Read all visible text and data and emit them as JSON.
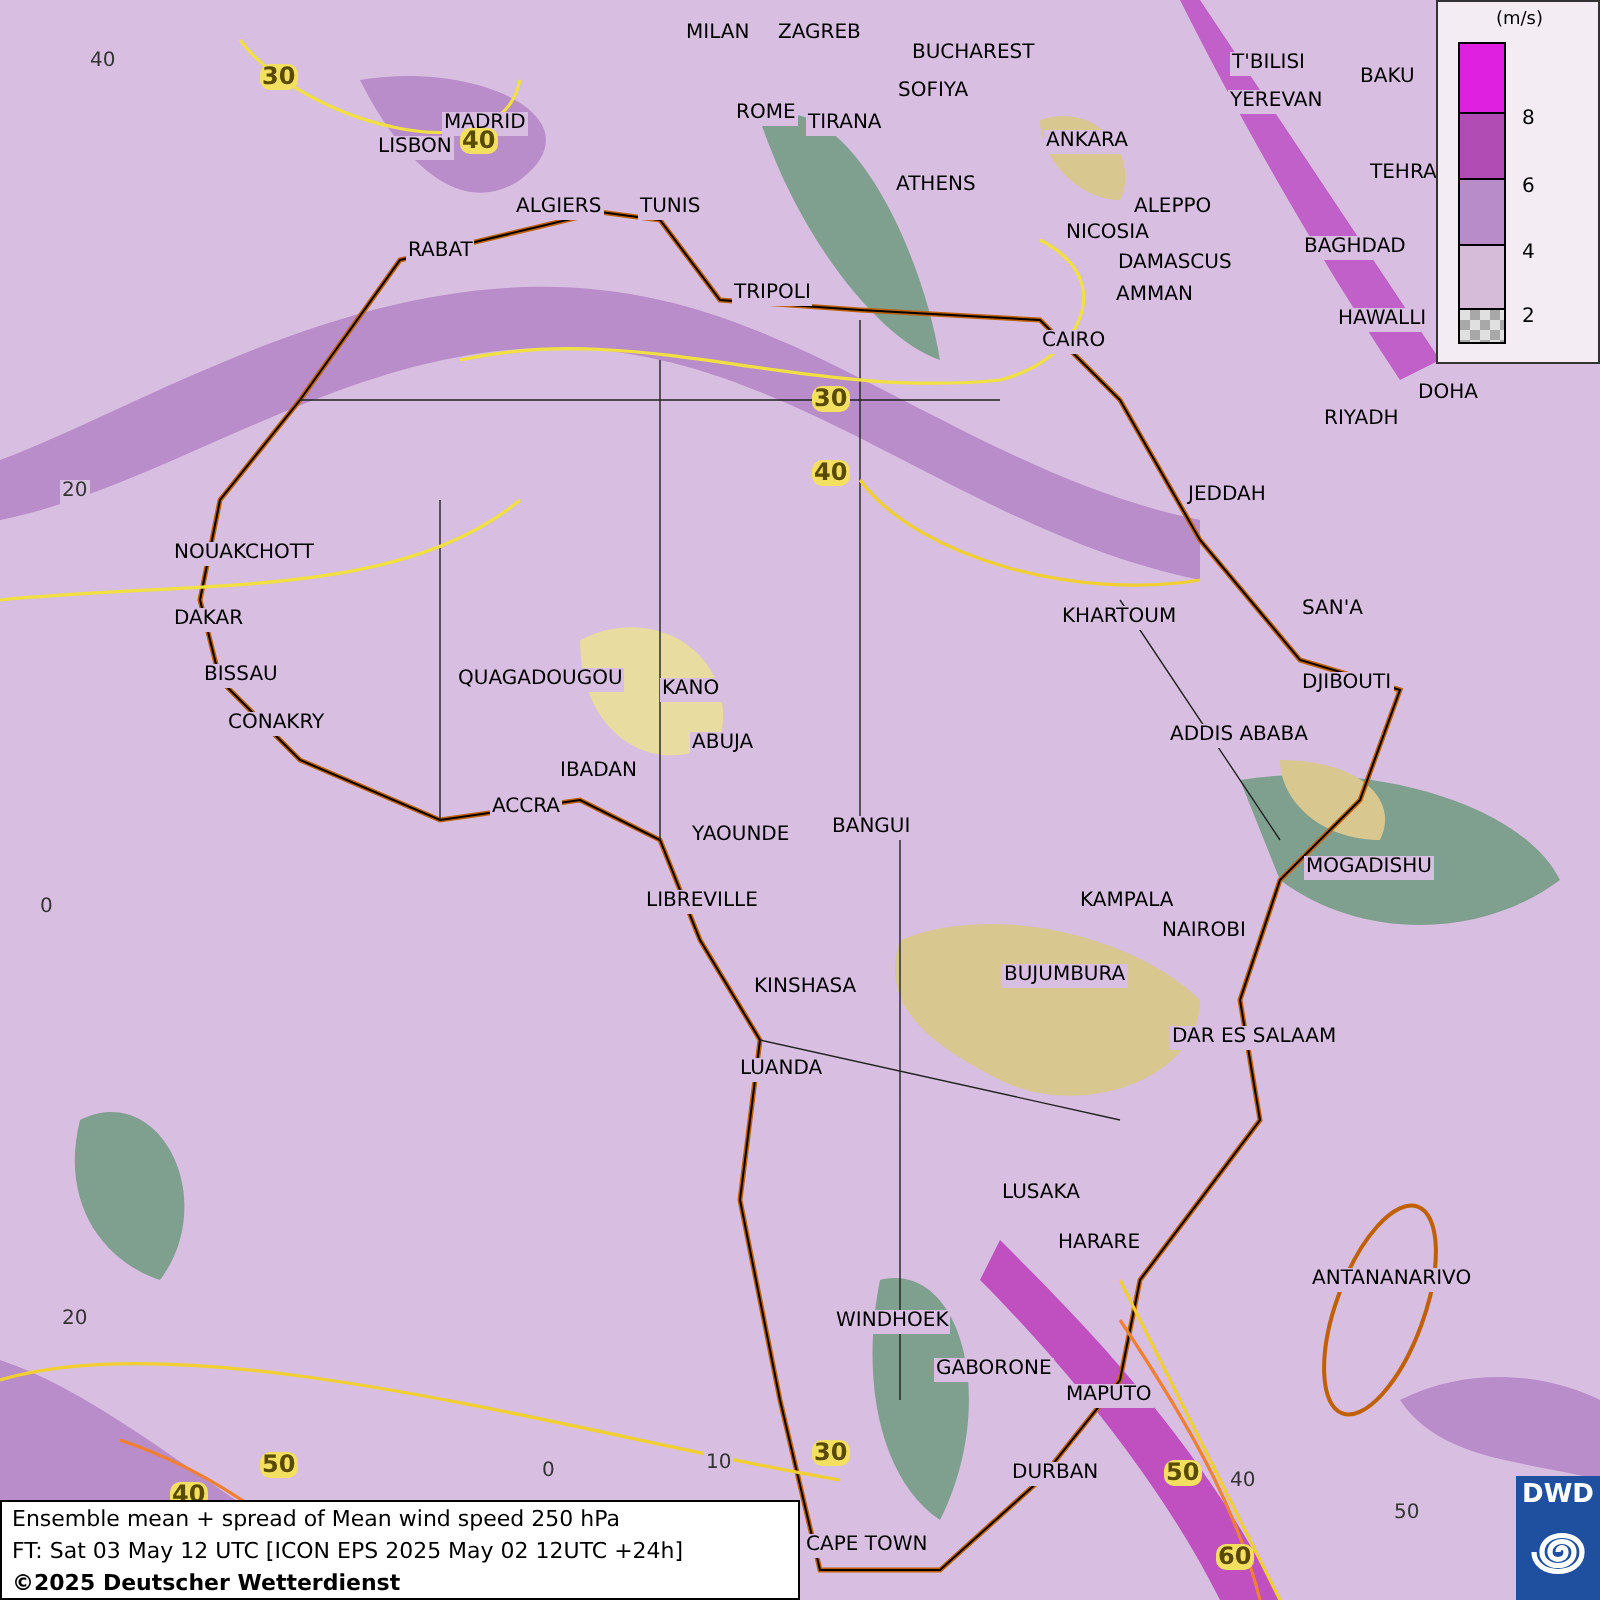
{
  "map": {
    "cities": [
      "MILAN",
      "ZAGREB",
      "BUCHAREST",
      "SOFIYA",
      "ROME",
      "TIRANA",
      "ANKARA",
      "T'BILISI",
      "YEREVAN",
      "BAKU",
      "TEHRA",
      "LISBON",
      "MADRID",
      "ALGIERS",
      "TUNIS",
      "RABAT",
      "ATHENS",
      "ALEPPO",
      "NICOSIA",
      "DAMASCUS",
      "BAGHDAD",
      "AMMAN",
      "TRIPOLI",
      "CAIRO",
      "HAWALLI",
      "DOHA",
      "RIYADH",
      "JEDDAH",
      "NOUAKCHOTT",
      "DAKAR",
      "KHARTOUM",
      "SAN'A",
      "BISSAU",
      "QUAGADOUGOU",
      "KANO",
      "DJIBOUTI",
      "CONAKRY",
      "ABUJA",
      "ADDIS ABABA",
      "IBADAN",
      "ACCRA",
      "YAOUNDE",
      "BANGUI",
      "MOGADISHU",
      "LIBREVILLE",
      "KAMPALA",
      "NAIROBI",
      "KINSHASA",
      "BUJUMBURA",
      "DAR ES SALAAM",
      "LUANDA",
      "LUSAKA",
      "HARARE",
      "ANTANANARIVO",
      "WINDHOEK",
      "GABORONE",
      "MAPUTO",
      "DURBAN",
      "CAPE TOWN"
    ],
    "latitude_labels": [
      "40",
      "20",
      "0",
      "20"
    ],
    "longitude_labels": [
      "0",
      "10",
      "40",
      "50"
    ],
    "contour_labels": [
      "30",
      "40",
      "30",
      "40",
      "30",
      "40",
      "50",
      "50",
      "60"
    ]
  },
  "legend": {
    "unit": "(m/s)",
    "bands": [
      {
        "kind": "solid",
        "color": "#e020e0"
      },
      {
        "kind": "solid",
        "color": "#b04cb4"
      },
      {
        "kind": "solid",
        "color": "#b88cc8"
      },
      {
        "kind": "solid",
        "color": "#d6bcd8"
      },
      {
        "kind": "checker",
        "color": "#a8a8a8"
      }
    ],
    "ticks": [
      "8",
      "6",
      "4",
      "2"
    ]
  },
  "caption": {
    "title": "Ensemble mean + spread of Mean wind speed 250 hPa",
    "forecast_time": "FT: Sat 03 May 12 UTC [ICON EPS 2025 May 02 12UTC +24h]",
    "copyright": "©2025 Deutscher Wetterdienst"
  },
  "logo": {
    "text": "DWD"
  }
}
